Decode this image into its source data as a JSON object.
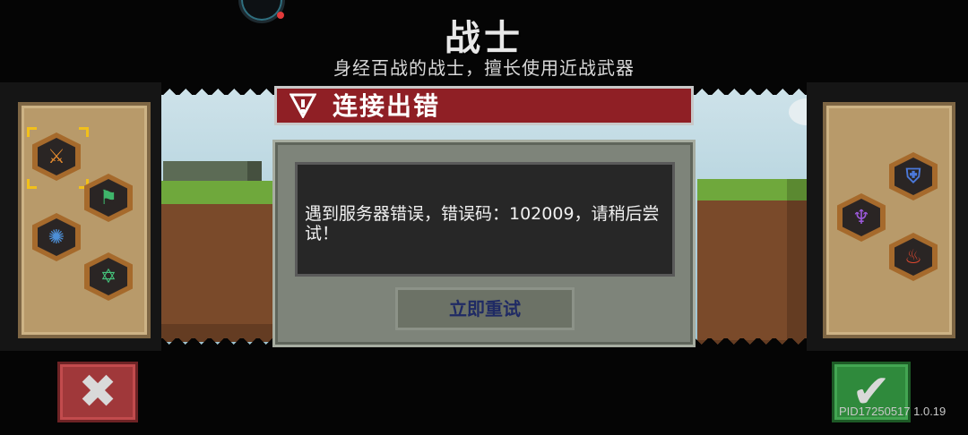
{
  "header": {
    "title": "战士",
    "subtitle": "身经百战的战士，擅长使用近战武器"
  },
  "dialog": {
    "title": "连接出错",
    "message": "遇到服务器错误，错误码：102009，请稍后尝试！",
    "retry_label": "立即重试"
  },
  "left_skills": [
    {
      "icon": "claw-slash-icon",
      "glyph": "⚔",
      "color": "#e48a2e",
      "selected": true
    },
    {
      "icon": "bow-icon",
      "glyph": "⚑",
      "color": "#3fb56a",
      "selected": false
    },
    {
      "icon": "vortex-icon",
      "glyph": "✺",
      "color": "#4d8fd6",
      "selected": false
    },
    {
      "icon": "hexagram-icon",
      "glyph": "✡",
      "color": "#44c27a",
      "selected": false
    }
  ],
  "right_skills": [
    {
      "icon": "shield-icon",
      "glyph": "⛨",
      "color": "#4b78d8"
    },
    {
      "icon": "purple-crest-icon",
      "glyph": "♆",
      "color": "#9b59d9"
    },
    {
      "icon": "flame-icon",
      "glyph": "♨",
      "color": "#e1482f"
    }
  ],
  "buttons": {
    "cancel_glyph": "✖",
    "confirm_glyph": "✔"
  },
  "footer": {
    "version": "PID17250517 1.0.19"
  }
}
